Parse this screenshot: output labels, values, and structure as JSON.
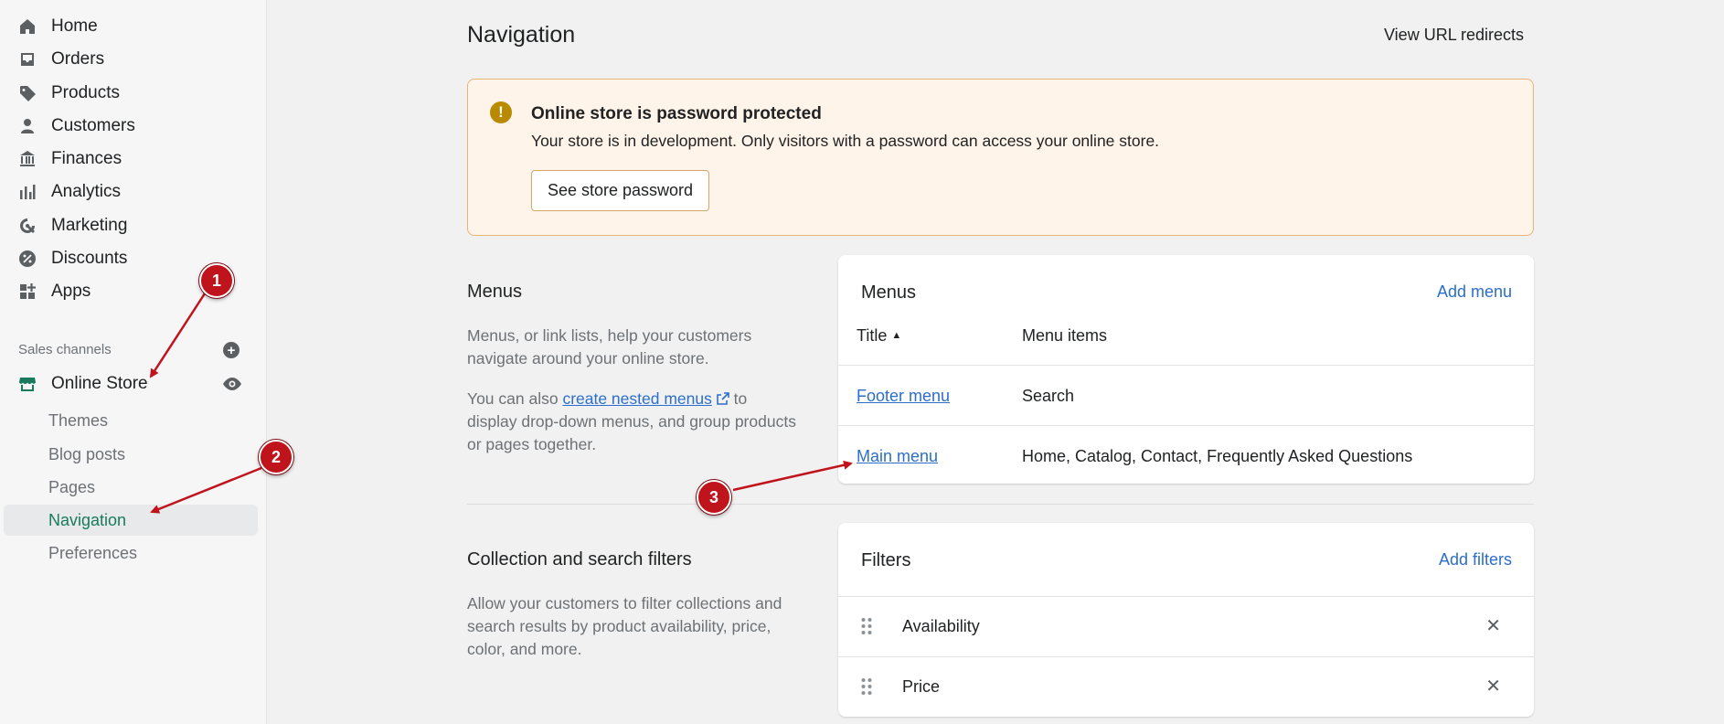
{
  "sidebar": {
    "items": [
      {
        "label": "Home",
        "icon": "home-icon"
      },
      {
        "label": "Orders",
        "icon": "inbox-icon"
      },
      {
        "label": "Products",
        "icon": "tag-icon"
      },
      {
        "label": "Customers",
        "icon": "person-icon"
      },
      {
        "label": "Finances",
        "icon": "bank-icon"
      },
      {
        "label": "Analytics",
        "icon": "bar-chart-icon"
      },
      {
        "label": "Marketing",
        "icon": "target-icon"
      },
      {
        "label": "Discounts",
        "icon": "discount-icon"
      },
      {
        "label": "Apps",
        "icon": "apps-icon"
      }
    ],
    "sales_channels_label": "Sales channels",
    "online_store_label": "Online Store",
    "sub_items": [
      {
        "label": "Themes"
      },
      {
        "label": "Blog posts"
      },
      {
        "label": "Pages"
      },
      {
        "label": "Navigation"
      },
      {
        "label": "Preferences"
      }
    ]
  },
  "header": {
    "title": "Navigation",
    "url_redirects": "View URL redirects"
  },
  "banner": {
    "title": "Online store is password protected",
    "text": "Your store is in development. Only visitors with a password can access your online store.",
    "button": "See store password"
  },
  "menus_section": {
    "title": "Menus",
    "desc1": "Menus, or link lists, help your customers navigate around your online store.",
    "desc2_prefix": "You can also ",
    "desc2_link": "create nested menus",
    "desc2_suffix": " to display drop-down menus, and group products or pages together.",
    "card_title": "Menus",
    "add_menu": "Add menu",
    "col_title": "Title",
    "col_items": "Menu items",
    "rows": [
      {
        "title": "Footer menu",
        "items": "Search"
      },
      {
        "title": "Main menu",
        "items": "Home, Catalog, Contact, Frequently Asked Questions"
      }
    ]
  },
  "filters_section": {
    "title": "Collection and search filters",
    "desc": "Allow your customers to filter collections and search results by product availability, price, color, and more.",
    "card_title": "Filters",
    "add_filters": "Add filters",
    "rows": [
      {
        "label": "Availability"
      },
      {
        "label": "Price"
      }
    ]
  },
  "annotations": {
    "marker1": "1",
    "marker2": "2",
    "marker3": "3"
  },
  "colors": {
    "accent_green": "#1a7a5e",
    "link_blue": "#2c6ecb",
    "banner_bg": "#fff4e9",
    "marker_red": "#c0141c"
  }
}
